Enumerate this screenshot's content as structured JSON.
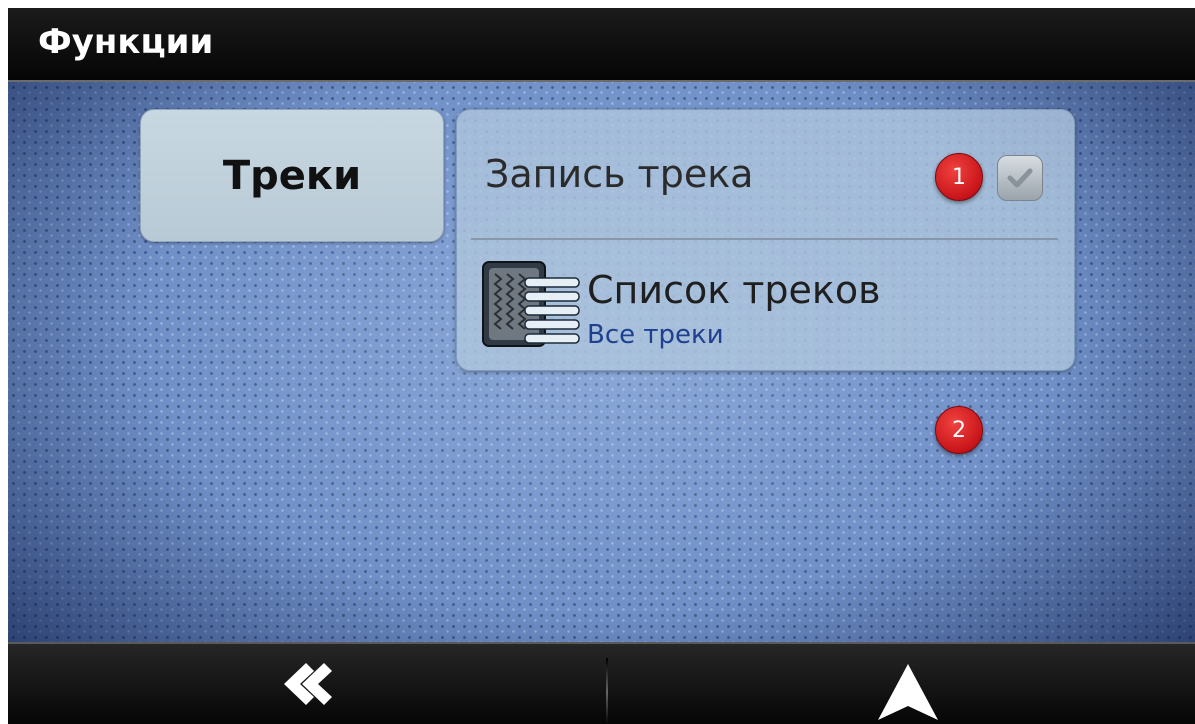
{
  "header": {
    "title": "Функции"
  },
  "section_tab": {
    "label": "Треки"
  },
  "panel": {
    "record_track": {
      "label": "Запись трека",
      "checked": true,
      "badge": "1"
    },
    "track_list": {
      "title": "Список треков",
      "subtitle": "Все треки",
      "badge": "2",
      "icon": "track-list-icon"
    }
  },
  "footer": {
    "back_icon": "double-chevron-left-icon",
    "navigate_icon": "navigation-arrow-icon"
  },
  "colors": {
    "header_bg": "#0a0a0a",
    "main_bg": "#6f8fc6",
    "badge": "#d0161b",
    "subtitle": "#1f3f8f"
  }
}
